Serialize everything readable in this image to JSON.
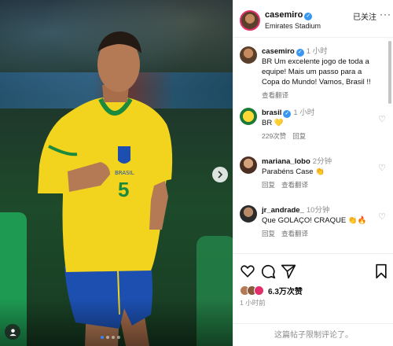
{
  "post": {
    "username": "casemiro",
    "location": "Emirates Stadium",
    "follow_label": "已关注",
    "more_label": "···"
  },
  "caption": {
    "username": "casemiro",
    "time": "1 小时",
    "text": "BR Um excelente jogo de toda a equipe! Mais um passo para a Copa do Mundo! Vamos, Brasil !!",
    "translate": "查看翻译"
  },
  "comments": [
    {
      "username": "brasil",
      "time": "1 小时",
      "text": "BR 💛",
      "likes": "229次赞",
      "reply": "回复"
    },
    {
      "username": "mariana_lobo",
      "time": "2分钟",
      "text": "Parabéns Case 👏",
      "reply": "回复",
      "translate": "查看翻译"
    },
    {
      "username": "jr_andrade_",
      "time": "10分钟",
      "text": "Que GOLAÇO! CRAQUE 👏🔥",
      "reply": "回复",
      "translate": "查看翻译"
    }
  ],
  "footer": {
    "likes": "6.3万次赞",
    "ago": "1 小时前",
    "comments_disabled": "这篇帖子限制评论了。"
  },
  "jersey": {
    "number": "5",
    "badge": "BRASIL"
  },
  "icons": {
    "like": "heart-icon",
    "comment": "comment-icon",
    "share": "share-icon",
    "save": "bookmark-icon",
    "next": "chevron-right-icon",
    "tag": "user-tag-icon",
    "verified": "verified-badge-icon"
  },
  "colors": {
    "accent": "#3897f0",
    "jersey_yellow": "#f2d31d",
    "shorts_blue": "#1c4fb0"
  }
}
